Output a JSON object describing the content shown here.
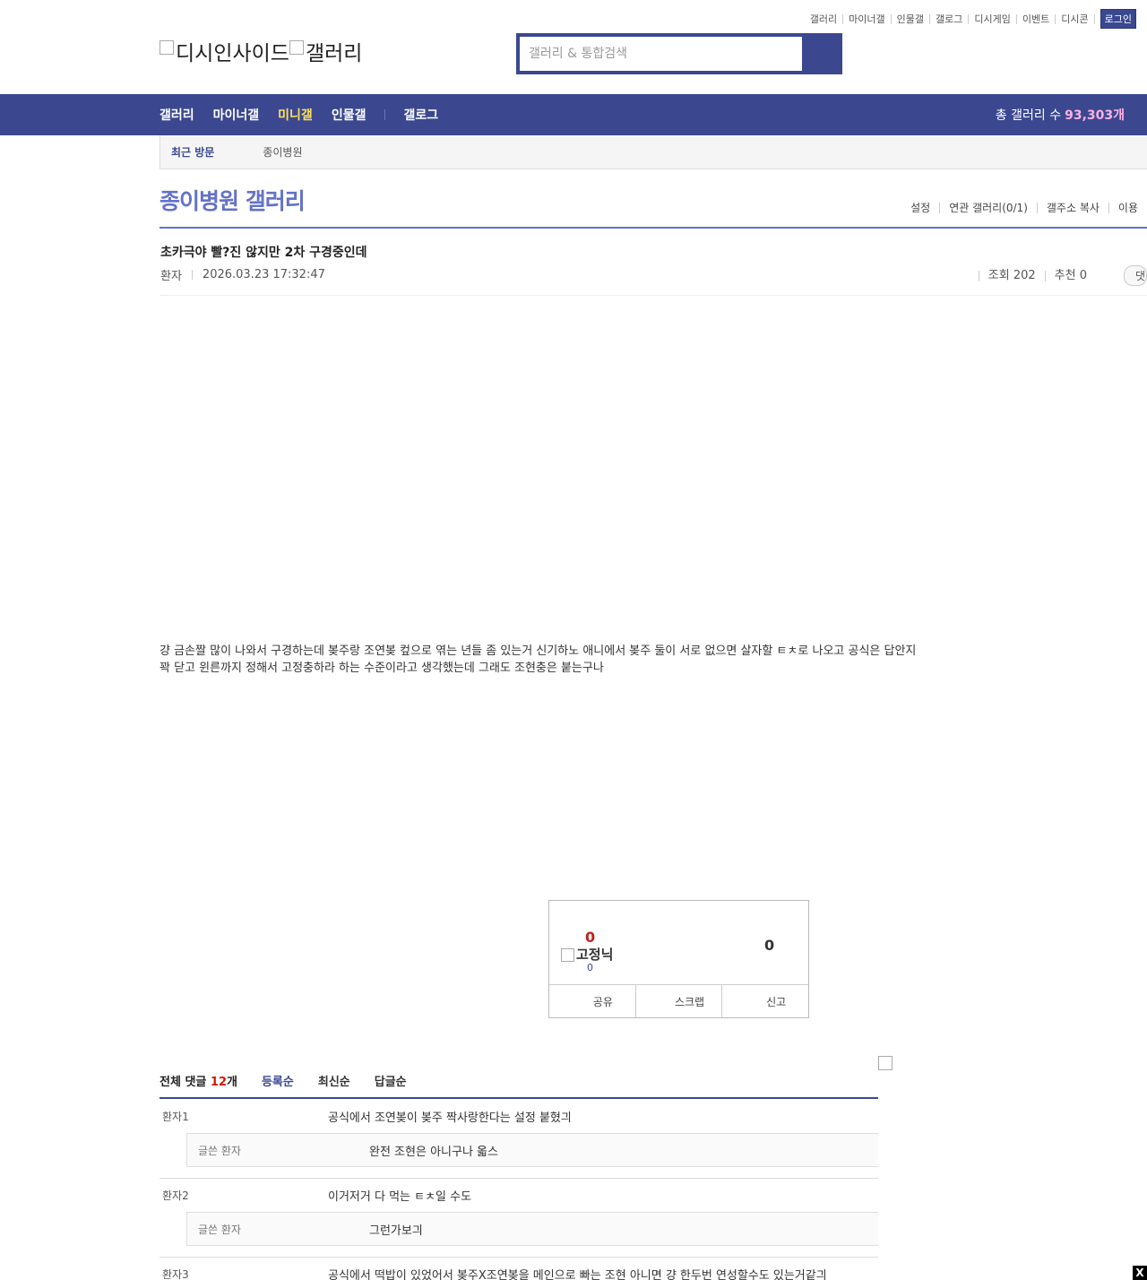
{
  "top_links": [
    "갤러리",
    "마이너갤",
    "인물갤",
    "갤로그",
    "디시게임",
    "이벤트",
    "디시콘"
  ],
  "login_label": "로그인",
  "logo": {
    "alt1": "디시인사이드",
    "alt2": "갤러리"
  },
  "search": {
    "placeholder": "갤러리 & 통합검색"
  },
  "gnb": {
    "items": [
      "갤러리",
      "마이너갤",
      "미니갤",
      "인물갤",
      "갤로그"
    ],
    "count_label": "총 갤러리 수",
    "count_value": "93,303개"
  },
  "recent": {
    "title": "최근 방문",
    "item": "종이병원"
  },
  "gallery": {
    "title": "종이병원 갤러리",
    "options": [
      "설정",
      "연관 갤러리(0/1)",
      "갤주소 복사",
      "이용"
    ]
  },
  "post": {
    "title": "초카극야 빨?진 않지만 2차 구경중인데",
    "writer": "환자",
    "date": "2026.03.23 17:32:47",
    "views": "조회 202",
    "recommend": "추천 0",
    "mini_btn": "댓",
    "body_line1": "걍 금손짤 많이 나와서 구경하는데 봊주랑 조연봊 컾으로 엮는 년들 좀 있는거 신기하노 애니에서 봊주 둘이 서로 없으면 살자할 ㅌㅊ로 나오고 공식은 답안지",
    "body_line2": "꽉 닫고 윈른까지 정해서 고정충하라 하는 수준이라고 생각했는데 그래도 조현충은 붙는구나"
  },
  "reco": {
    "up": "0",
    "fix_label": "고정닉",
    "fix_count": "0",
    "down": "0",
    "share": "공유",
    "scrap": "스크랩",
    "report": "신고"
  },
  "comments": {
    "total_label": "전체 댓글",
    "total_count": "12",
    "total_unit": "개",
    "sorts": [
      "등록순",
      "최신순",
      "답글순"
    ],
    "list": [
      {
        "nick": "환자1",
        "text": "공식에서 조연봊이 봊주 짝사랑한다는 설정 붙혔긔",
        "reply": {
          "nick": "글쓴 환자",
          "text": "완전 조현은 아니구나 옯스"
        }
      },
      {
        "nick": "환자2",
        "text": "이거저거 다 먹는 ㅌㅊ일 수도",
        "reply": {
          "nick": "글쓴 환자",
          "text": "그런가보긔"
        }
      },
      {
        "nick": "환자3",
        "text": "공식에서 떡밥이 있었어서 봊주X조연봊을 메인으로 빠는 조현 아니면 걍 한두번 연성할수도 있는거같긔"
      }
    ]
  },
  "close_label": "X"
}
